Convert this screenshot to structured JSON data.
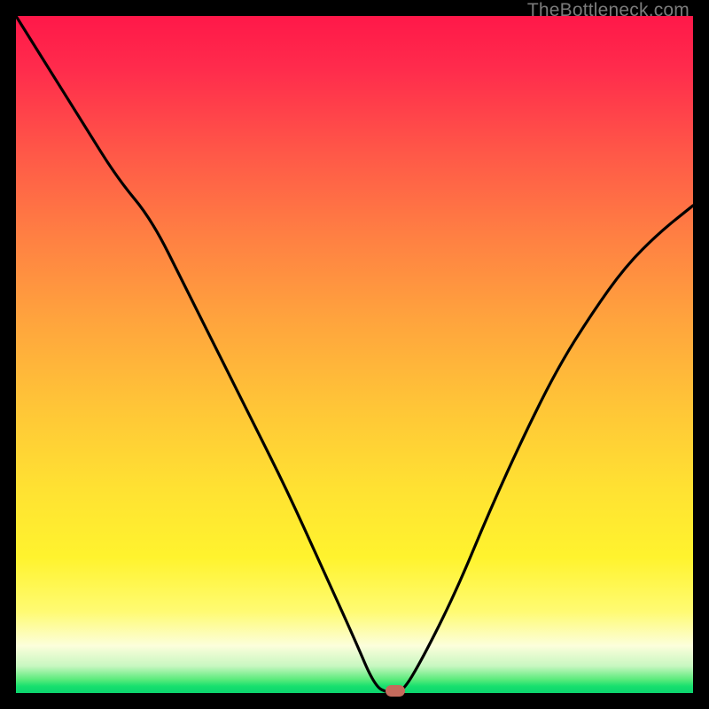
{
  "watermark": "TheBottleneck.com",
  "colors": {
    "frame": "#000000",
    "curve": "#000000",
    "marker": "#c56a5c"
  },
  "chart_data": {
    "type": "line",
    "title": "",
    "xlabel": "",
    "ylabel": "",
    "xlim": [
      0,
      100
    ],
    "ylim": [
      0,
      100
    ],
    "grid": false,
    "x": [
      0,
      5,
      10,
      15,
      20,
      25,
      30,
      35,
      40,
      45,
      50,
      53,
      55,
      57,
      60,
      65,
      70,
      75,
      80,
      85,
      90,
      95,
      100
    ],
    "values": [
      100,
      92,
      84,
      76,
      70,
      60,
      50,
      40,
      30,
      19,
      8,
      1,
      0,
      0,
      5,
      15,
      27,
      38,
      48,
      56,
      63,
      68,
      72
    ],
    "annotations": [
      {
        "type": "marker",
        "x": 56,
        "y": 0,
        "label": "optimal-point"
      }
    ],
    "background_gradient": {
      "orientation": "vertical",
      "stops": [
        {
          "pos": 0.0,
          "color": "#ff1849"
        },
        {
          "pos": 0.45,
          "color": "#ffa43d"
        },
        {
          "pos": 0.8,
          "color": "#fff32e"
        },
        {
          "pos": 0.96,
          "color": "#c8f7c1"
        },
        {
          "pos": 1.0,
          "color": "#0bd46e"
        }
      ]
    }
  }
}
